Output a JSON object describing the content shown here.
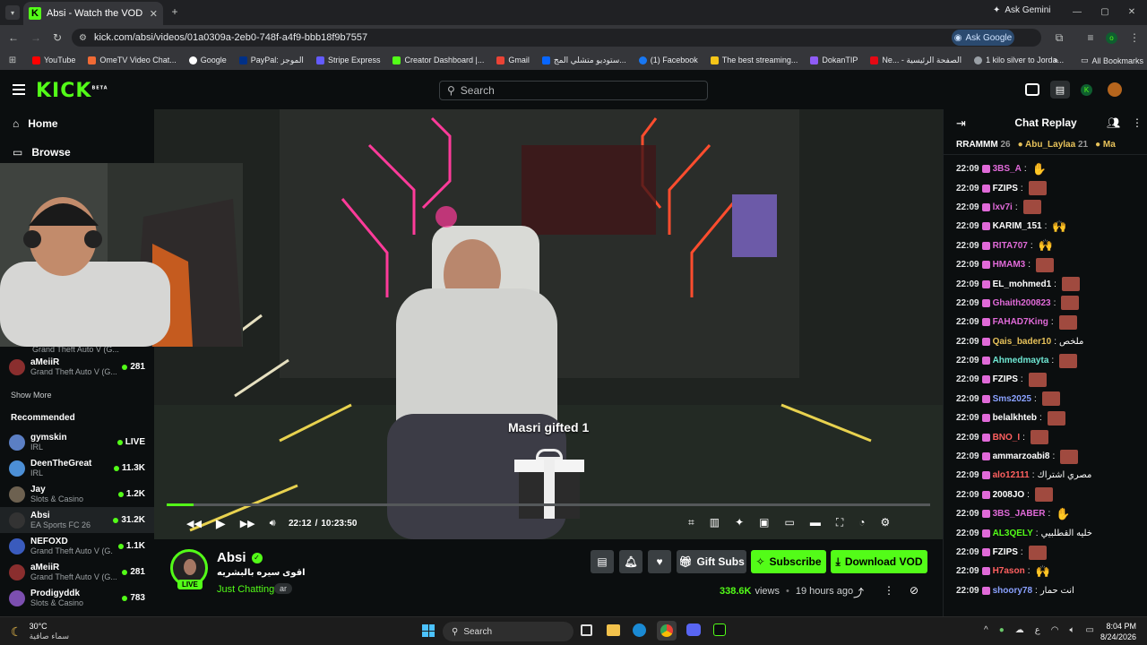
{
  "browser": {
    "tab_title": "Absi - Watch the VOD on Kick",
    "url": "kick.com/absi/videos/01a0309a-2eb0-748f-a4f9-bbb18f9b7557",
    "ask_gemini": "Ask Gemini",
    "ask_google": "Ask Google",
    "bookmarks": [
      "YouTube",
      "OmeTV Video Chat...",
      "Google",
      "PayPal: الموجز",
      "Stripe Express",
      "Creator Dashboard |...",
      "Gmail",
      "ستوديو متشلي المج...",
      "(1) Facebook",
      "The best streaming...",
      "DokanTIP",
      "Ne... - الصفحة الرئيسية",
      "1 kilo silver to Jorda..."
    ],
    "all_bookmarks": "All Bookmarks"
  },
  "kick": {
    "logo": "KICK",
    "beta": "BETA",
    "search_placeholder": "Search"
  },
  "sidebar": {
    "home": "Home",
    "browse": "Browse",
    "following": [
      {
        "category": "Grand Theft Auto V (G..."
      },
      {
        "name": "aMeiiR",
        "category": "Grand Theft Auto V (G...",
        "viewers": "281"
      }
    ],
    "show_more": "Show More",
    "recommended_label": "Recommended",
    "recommended": [
      {
        "name": "gymskin",
        "category": "IRL",
        "viewers": "LIVE",
        "color": "#5b7fc4"
      },
      {
        "name": "DeenTheGreat",
        "category": "IRL",
        "viewers": "11.3K",
        "color": "#4c8fd6"
      },
      {
        "name": "Jay",
        "category": "Slots & Casino",
        "viewers": "1.2K",
        "color": "#6d6150"
      },
      {
        "name": "Absi",
        "category": "EA Sports FC 26",
        "viewers": "31.2K",
        "color": "#333"
      },
      {
        "name": "NEFOXD",
        "category": "Grand Theft Auto V (G...",
        "viewers": "1.1K",
        "color": "#3a5bbd"
      },
      {
        "name": "aMeiiR",
        "category": "Grand Theft Auto V (G...",
        "viewers": "281",
        "color": "#8a2e2e"
      },
      {
        "name": "Prodigyddk",
        "category": "Slots & Casino",
        "viewers": "783",
        "color": "#7c4fb0"
      }
    ]
  },
  "player": {
    "gift_text": "Masri gifted 1",
    "time_current": "22:12",
    "time_separator": "/",
    "time_total": "10:23:50",
    "progress_fraction": 0.035
  },
  "stream": {
    "name": "Absi",
    "title": "اقوى سيره بالبشريه",
    "category": "Just Chatting",
    "language": "ar",
    "live_badge": "LIVE",
    "views": "338.6K",
    "views_label": "views",
    "ago": "19 hours ago",
    "gift_subs": "Gift Subs",
    "subscribe": "Subscribe",
    "download": "Download VOD"
  },
  "chat": {
    "title": "Chat Replay",
    "top_gifters": [
      {
        "name": "RRAMMM",
        "count": "26"
      },
      {
        "name": "Abu_Laylaa",
        "count": "21"
      },
      {
        "name": "Ma",
        "count": ""
      }
    ],
    "messages": [
      {
        "time": "22:09",
        "user": "3BS_A",
        "color": "#e06ad8",
        "text": "",
        "emote": "hand"
      },
      {
        "time": "22:09",
        "user": "FZIPS",
        "color": "#ffffff",
        "text": "",
        "emote": "face"
      },
      {
        "time": "22:09",
        "user": "lxv7i",
        "color": "#e06ad8",
        "text": "",
        "emote": "face"
      },
      {
        "time": "22:09",
        "user": "KARIM_151",
        "color": "#ffffff",
        "text": "",
        "emote": "hands"
      },
      {
        "time": "22:09",
        "user": "RITA707",
        "color": "#e06ad8",
        "text": "",
        "emote": "hands"
      },
      {
        "time": "22:09",
        "user": "HMAM3",
        "color": "#e06ad8",
        "text": "",
        "emote": "face"
      },
      {
        "time": "22:09",
        "user": "EL_mohmed1",
        "color": "#ffffff",
        "text": "",
        "emote": "face"
      },
      {
        "time": "22:09",
        "user": "Ghaith200823",
        "color": "#e06ad8",
        "text": "",
        "emote": "face"
      },
      {
        "time": "22:09",
        "user": "FAHAD7King",
        "color": "#e06ad8",
        "text": "",
        "emote": "face"
      },
      {
        "time": "22:09",
        "user": "Qais_bader10",
        "color": "#e7c25a",
        "text": "ملخص",
        "emote": ""
      },
      {
        "time": "22:09",
        "user": "Ahmedmayta",
        "color": "#6fe8d4",
        "text": "",
        "emote": "face"
      },
      {
        "time": "22:09",
        "user": "FZIPS",
        "color": "#ffffff",
        "text": "",
        "emote": "face"
      },
      {
        "time": "22:09",
        "user": "Sms2025",
        "color": "#8aa1ff",
        "text": "",
        "emote": "face"
      },
      {
        "time": "22:09",
        "user": "belalkhteb",
        "color": "#ffffff",
        "text": "",
        "emote": "face"
      },
      {
        "time": "22:09",
        "user": "BNO_I",
        "color": "#ff6060",
        "text": "",
        "emote": "face"
      },
      {
        "time": "22:09",
        "user": "ammarzoabi8",
        "color": "#ffffff",
        "text": "",
        "emote": "face"
      },
      {
        "time": "22:09",
        "user": "alo12111",
        "color": "#ff6060",
        "text": "مصري اشتراك",
        "emote": ""
      },
      {
        "time": "22:09",
        "user": "2008JO",
        "color": "#ffffff",
        "text": "",
        "emote": "face"
      },
      {
        "time": "22:09",
        "user": "3BS_JABER",
        "color": "#e06ad8",
        "text": "",
        "emote": "hand"
      },
      {
        "time": "22:09",
        "user": "AL3QELY",
        "color": "#53fc18",
        "text": "خليه القطلبيي",
        "emote": ""
      },
      {
        "time": "22:09",
        "user": "FZIPS",
        "color": "#ffffff",
        "text": "",
        "emote": "face"
      },
      {
        "time": "22:09",
        "user": "H7ason",
        "color": "#ff6060",
        "text": "",
        "emote": "hands"
      },
      {
        "time": "22:09",
        "user": "shoory78",
        "color": "#8aa1ff",
        "text": "انت حمار",
        "emote": ""
      }
    ]
  },
  "taskbar": {
    "weather_temp": "30°C",
    "weather_desc": "سماء صافية",
    "search": "Search",
    "lang": "ع",
    "time": "8:04 PM",
    "date": "8/24/2026"
  }
}
